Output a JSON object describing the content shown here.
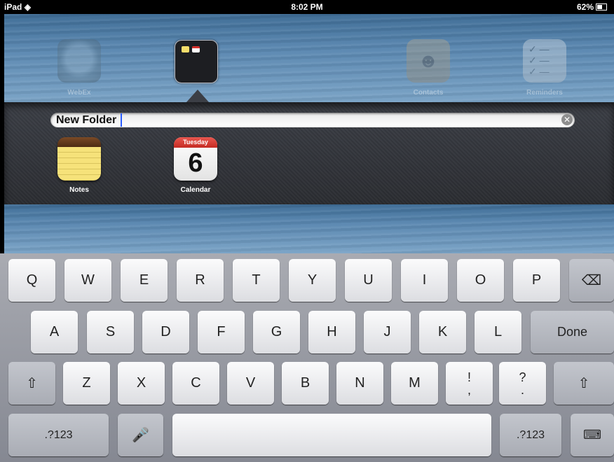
{
  "status_bar": {
    "device": "iPad",
    "time": "8:02 PM",
    "battery": "62%"
  },
  "home_icons": [
    {
      "label": "WebEx"
    },
    {
      "label": "Contacts"
    },
    {
      "label": "Reminders"
    }
  ],
  "folder": {
    "name": "New Folder",
    "apps": [
      {
        "label": "Notes"
      },
      {
        "label": "Calendar",
        "day_name": "Tuesday",
        "day_number": "6"
      }
    ]
  },
  "keyboard": {
    "row1": [
      "Q",
      "W",
      "E",
      "R",
      "T",
      "Y",
      "U",
      "I",
      "O",
      "P"
    ],
    "row2": [
      "A",
      "S",
      "D",
      "F",
      "G",
      "H",
      "J",
      "K",
      "L"
    ],
    "row3": [
      "Z",
      "X",
      "C",
      "V",
      "B",
      "N",
      "M"
    ],
    "row3_punct": [
      {
        "top": "!",
        "bottom": ","
      },
      {
        "top": "?",
        "bottom": "."
      }
    ],
    "done_label": "Done",
    "numbers_label": ".?123"
  },
  "colors": {
    "caret": "#2a5cff",
    "calendar_red": "#d8322d"
  }
}
